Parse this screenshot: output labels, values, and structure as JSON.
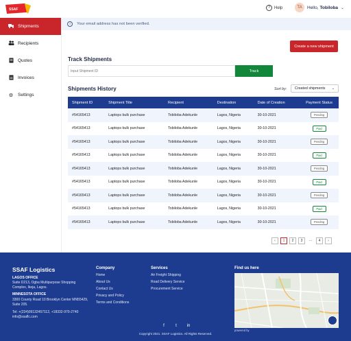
{
  "header": {
    "logo_text": "SSAF",
    "help_label": "Help",
    "avatar_initials": "TA",
    "greeting": "Hello,",
    "user_name": "Tobiloba"
  },
  "sidebar": {
    "items": [
      {
        "label": "Shipments",
        "icon": "truck-icon",
        "active": true
      },
      {
        "label": "Recipients",
        "icon": "users-icon",
        "active": false
      },
      {
        "label": "Quotes",
        "icon": "document-icon",
        "active": false
      },
      {
        "label": "Invoices",
        "icon": "invoice-icon",
        "active": false
      },
      {
        "label": "Settings",
        "icon": "gear-icon",
        "active": false
      }
    ]
  },
  "notice": {
    "text": "Your email address has not been verified."
  },
  "actions": {
    "create_label": "Create a new shipment"
  },
  "track": {
    "title": "Track Shipments",
    "placeholder": "Input Shipment ID",
    "button_label": "Track"
  },
  "history": {
    "title": "Shipments History",
    "sort_label": "Sort by:",
    "sort_value": "Created shipments",
    "columns": [
      "Shipment ID",
      "Shipment Title",
      "Recipient",
      "Destination",
      "Date of Creation",
      "Payment Status"
    ],
    "rows": [
      {
        "id": "#54165413",
        "title": "Laptops bulk purchase",
        "recipient": "Tobiloba Adekunle",
        "destination": "Lagos, Nigeria",
        "date": "30-10-2021",
        "status": "Pending"
      },
      {
        "id": "#54165413",
        "title": "Laptops bulk purchase",
        "recipient": "Tobiloba Adekunle",
        "destination": "Lagos, Nigeria",
        "date": "30-10-2021",
        "status": "Paid"
      },
      {
        "id": "#54165413",
        "title": "Laptops bulk purchase",
        "recipient": "Tobiloba Adekunle",
        "destination": "Lagos, Nigeria",
        "date": "30-10-2021",
        "status": "Pending"
      },
      {
        "id": "#54165413",
        "title": "Laptops bulk purchase",
        "recipient": "Tobiloba Adekunle",
        "destination": "Lagos, Nigeria",
        "date": "30-10-2021",
        "status": "Paid"
      },
      {
        "id": "#54165413",
        "title": "Laptops bulk purchase",
        "recipient": "Tobiloba Adekunle",
        "destination": "Lagos, Nigeria",
        "date": "30-10-2021",
        "status": "Pending"
      },
      {
        "id": "#54165413",
        "title": "Laptops bulk purchase",
        "recipient": "Tobiloba Adekunle",
        "destination": "Lagos, Nigeria",
        "date": "30-10-2021",
        "status": "Paid"
      },
      {
        "id": "#54165413",
        "title": "Laptops bulk purchase",
        "recipient": "Tobiloba Adekunle",
        "destination": "Lagos, Nigeria",
        "date": "30-10-2021",
        "status": "Pending"
      },
      {
        "id": "#54165413",
        "title": "Laptops bulk purchase",
        "recipient": "Tobiloba Adekunle",
        "destination": "Lagos, Nigeria",
        "date": "30-10-2021",
        "status": "Paid"
      },
      {
        "id": "#54165413",
        "title": "Laptops bulk purchase",
        "recipient": "Tobiloba Adekunle",
        "destination": "Lagos, Nigeria",
        "date": "30-10-2021",
        "status": "Pending"
      }
    ]
  },
  "pagination": {
    "prev": "‹",
    "pages": [
      "1",
      "2",
      "3",
      "...",
      "4"
    ],
    "next": "›"
  },
  "footer": {
    "brand": "SSAF Logistics",
    "lagos_title": "LAGOS OFFICE",
    "lagos_address_1": "Suite D213, Ogba Multipurpose Shopping",
    "lagos_address_2": "Complex, Ikeja, Lagos.",
    "mn_title": "MINNESOTA OFFICE",
    "mn_address_1": "3300 County Road 10 Brooklyn Center MN55429,",
    "mn_address_2": "Suite 205.",
    "phone": "Tel: +(234)09132457112, +18332-970-2740",
    "email": "info@ssaflc.com",
    "company_title": "Company",
    "company_links": [
      "Home",
      "About Us",
      "Contact Us",
      "Privacy and Policy",
      "Terms and Conditions"
    ],
    "services_title": "Services",
    "services_links": [
      "Air Freight Shipping",
      "Road Delivery Service",
      "Procurement Service"
    ],
    "map_title": "Find us here",
    "powered_by": "powered by",
    "copyright": "Copyright 2021. SSAF Logistics. All Rights Reserved."
  },
  "colors": {
    "brand_red": "#c8262a",
    "brand_navy": "#1d3c8f",
    "track_green": "#12873b"
  }
}
